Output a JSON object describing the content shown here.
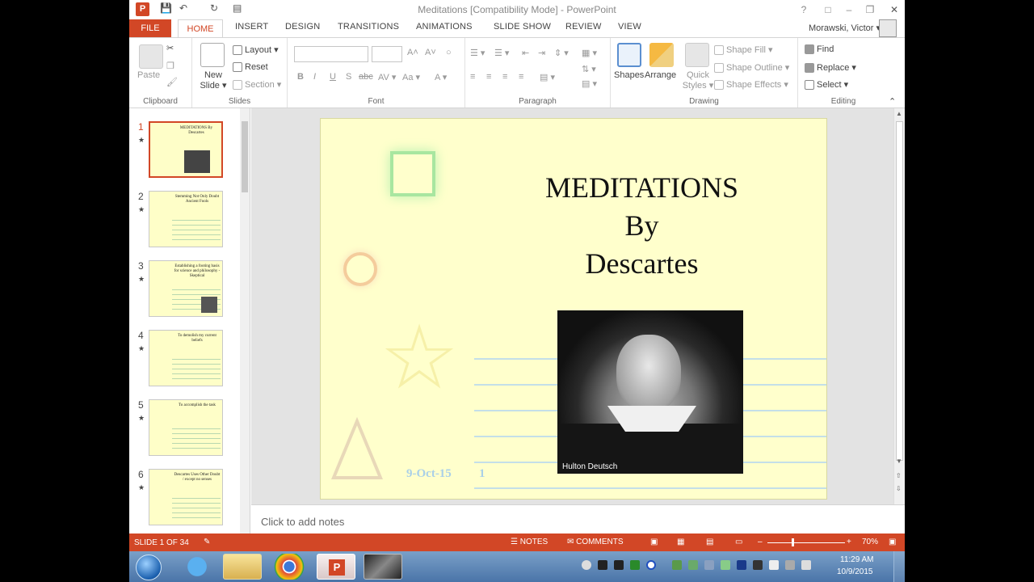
{
  "app": {
    "title": "Meditations [Compatibility Mode] - PowerPoint",
    "logo": "P",
    "user": "Morawski, Victor ▾"
  },
  "tabs": [
    "FILE",
    "HOME",
    "INSERT",
    "DESIGN",
    "TRANSITIONS",
    "ANIMATIONS",
    "SLIDE SHOW",
    "REVIEW",
    "VIEW"
  ],
  "ribbon": {
    "clipboard": {
      "paste": "Paste",
      "label": "Clipboard"
    },
    "slides": {
      "new_slide": "New Slide ▾",
      "layout": "Layout ▾",
      "reset": "Reset",
      "section": "Section ▾",
      "label": "Slides"
    },
    "font": {
      "label": "Font",
      "bold": "B",
      "italic": "I",
      "underline": "U",
      "strike": "S",
      "abc": "abc",
      "av": "AV ▾",
      "aa": "Aa ▾",
      "color": "A ▾",
      "grow": "A˄",
      "shrink": "A˅"
    },
    "paragraph": {
      "label": "Paragraph"
    },
    "drawing": {
      "shapes": "Shapes",
      "arrange": "Arrange",
      "quick_styles": "Quick Styles ▾",
      "fill": "Shape Fill ▾",
      "outline": "Shape Outline ▾",
      "effects": "Shape Effects ▾",
      "label": "Drawing"
    },
    "editing": {
      "find": "Find",
      "replace": "Replace ▾",
      "select": "Select ▾",
      "label": "Editing"
    }
  },
  "thumbnails": [
    {
      "num": "1",
      "star": "★",
      "title": "MEDITATIONS By Descartes"
    },
    {
      "num": "2",
      "star": "★",
      "title": "Stemming Not Only Doubt Ancient Fools"
    },
    {
      "num": "3",
      "star": "★",
      "title": "Establishing a footing basis for science and philosophy - Skeptical"
    },
    {
      "num": "4",
      "star": "★",
      "title": "To demolish my current beliefs"
    },
    {
      "num": "5",
      "star": "★",
      "title": "To accomplish the task"
    },
    {
      "num": "6",
      "star": "★",
      "title": "Descartes Uses Other Doubt / except no senses"
    }
  ],
  "slide": {
    "title_lines": [
      "MEDITATIONS",
      "By",
      "Descartes"
    ],
    "image_caption": "Hulton Deutsch",
    "date": "9-Oct-15",
    "number": "1"
  },
  "notes": {
    "placeholder": "Click to add notes"
  },
  "status": {
    "slide_count": "SLIDE 1 OF 34",
    "notes": "NOTES",
    "comments": "COMMENTS",
    "zoom": "70%"
  },
  "taskbar": {
    "time": "11:29 AM",
    "date": "10/9/2015"
  },
  "colors": {
    "accent": "#d24726",
    "slide_bg": "#ffffcc",
    "line": "#c4dfe8"
  }
}
